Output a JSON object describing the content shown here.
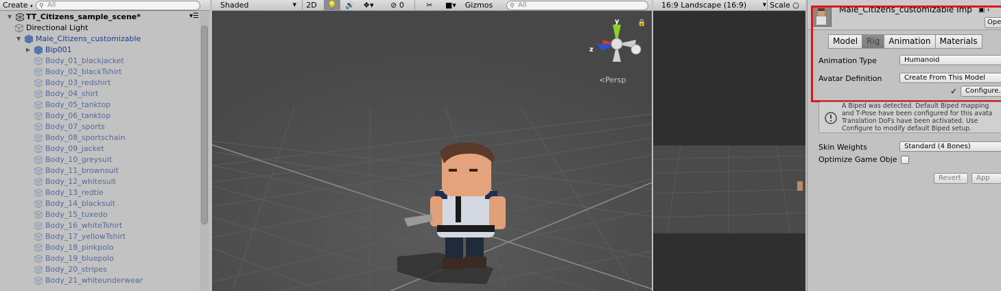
{
  "hierarchy": {
    "create_label": "Create",
    "search_placeholder": "All",
    "scene_name": "TT_Citizens_sample_scene*",
    "items": [
      {
        "label": "Directional Light"
      },
      {
        "label": "Male_Citizens_customizable"
      },
      {
        "label": "Bip001"
      },
      {
        "label": "Body_01_blackjacket"
      },
      {
        "label": "Body_02_blackTshirt"
      },
      {
        "label": "Body_03_redshirt"
      },
      {
        "label": "Body_04_shirt"
      },
      {
        "label": "Body_05_tanktop"
      },
      {
        "label": "Body_06_tanktop"
      },
      {
        "label": "Body_07_sports"
      },
      {
        "label": "Body_08_sportschain"
      },
      {
        "label": "Body_09_jacket"
      },
      {
        "label": "Body_10_greysuit"
      },
      {
        "label": "Body_11_brownsuit"
      },
      {
        "label": "Body_12_whitesuit"
      },
      {
        "label": "Body_13_redtie"
      },
      {
        "label": "Body_14_blacksuit"
      },
      {
        "label": "Body_15_tuxedo"
      },
      {
        "label": "Body_16_whiteTshirt"
      },
      {
        "label": "Body_17_yellowTshirt"
      },
      {
        "label": "Body_18_pinkpolo"
      },
      {
        "label": "Body_19_bluepolo"
      },
      {
        "label": "Body_20_stripes"
      },
      {
        "label": "Body_21_whiteunderwear"
      }
    ]
  },
  "scene": {
    "shading_mode": "Shaded",
    "mode_2d": "2D",
    "hidden_count": "0",
    "gizmos_label": "Gizmos",
    "search_placeholder": "All",
    "projection_label": "Persp",
    "axis_labels": {
      "y": "y",
      "z": "z"
    }
  },
  "game": {
    "aspect_label": "16:9 Landscape (16:9)",
    "scale_label": "Scale"
  },
  "inspector": {
    "title": "Male_Citizens_customizable Imp",
    "open_label": "Ope",
    "tabs": [
      {
        "label": "Model",
        "active": false
      },
      {
        "label": "Rig",
        "active": true
      },
      {
        "label": "Animation",
        "active": false
      },
      {
        "label": "Materials",
        "active": false
      }
    ],
    "animation_type_label": "Animation Type",
    "animation_type_value": "Humanoid",
    "avatar_definition_label": "Avatar Definition",
    "avatar_definition_value": "Create From This Model",
    "configure_label": "Configure...",
    "check_mark": "✓",
    "help_lines": [
      "A Biped was detected. Default Biped mapping",
      "and T-Pose have been configured for this avata",
      "Translation DoFs have been activated. Use",
      "Configure to modify default Biped setup."
    ],
    "skin_weights_label": "Skin Weights",
    "skin_weights_value": "Standard (4 Bones)",
    "optimize_label": "Optimize Game Obje",
    "optimize_checked": false,
    "revert_label": "Revert",
    "apply_label": "App"
  },
  "colors": {
    "highlight_border": "#e0141c",
    "scene_background": "#484848",
    "link_blue": "#1b3a8f"
  }
}
